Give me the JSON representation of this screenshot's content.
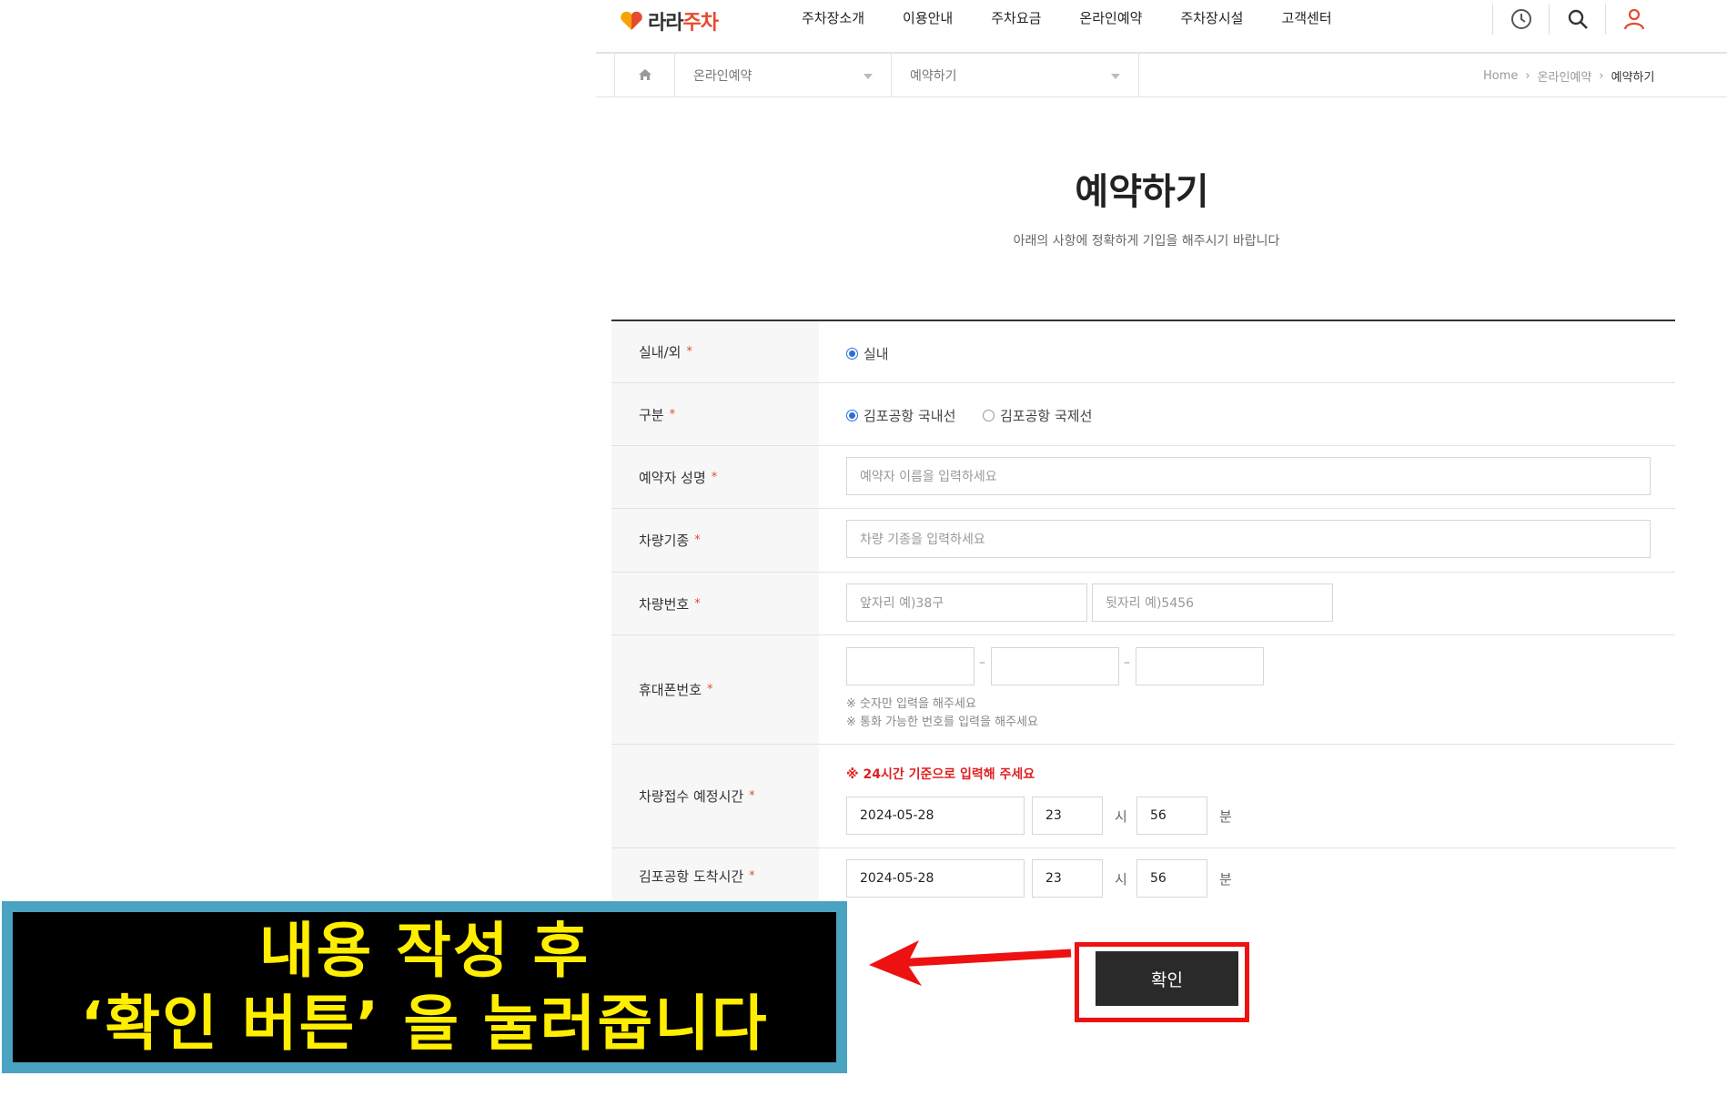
{
  "header": {
    "logo": {
      "part1": "라라",
      "part2": "주차"
    },
    "nav": [
      "주차장소개",
      "이용안내",
      "주차요금",
      "온라인예약",
      "주차장시설",
      "고객센터"
    ],
    "icons": [
      "clock-icon",
      "search-icon",
      "user-icon"
    ]
  },
  "subnav": {
    "menu1": "온라인예약",
    "menu2": "예약하기",
    "breadcrumb": [
      "Home",
      "온라인예약",
      "예약하기"
    ]
  },
  "page": {
    "title": "예약하기",
    "subtitle": "아래의 사항에 정확하게 기입을 해주시기 바랍니다"
  },
  "form": {
    "star": "*",
    "indoor": {
      "label": "실내/외",
      "option": "실내"
    },
    "category": {
      "label": "구분",
      "options": [
        "김포공항 국내선",
        "김포공항 국제선"
      ],
      "selected": "김포공항 국내선"
    },
    "name": {
      "label": "예약자 성명",
      "placeholder": "예약자 이름을 입력하세요"
    },
    "car_model": {
      "label": "차량기종",
      "placeholder": "차량 기종을 입력하세요"
    },
    "car_number": {
      "label": "차량번호",
      "front_placeholder": "앞자리 예)38구",
      "back_placeholder": "뒷자리 예)5456"
    },
    "phone": {
      "label": "휴대폰번호",
      "dash": "–",
      "notes": [
        "※ 숫자만 입력을 해주세요",
        "※ 통화 가능한 번호를 입력을 해주세요"
      ]
    },
    "arrival_time": {
      "label": "차량접수 예정시간",
      "warning": "※ 24시간 기준으로 입력해 주세요",
      "date": "2024-05-28",
      "hour": "23",
      "minute": "56",
      "hour_unit": "시",
      "minute_unit": "분"
    },
    "airport_time": {
      "label": "김포공항 도착시간",
      "date": "2024-05-28",
      "hour": "23",
      "minute": "56",
      "hour_unit": "시",
      "minute_unit": "분"
    },
    "confirm": "확인"
  },
  "callout": {
    "line1": "내용 작성 후",
    "line2": "‘확인 버튼’ 을 눌러줍니다"
  },
  "colors": {
    "accent": "#e64a2e",
    "radio": "#2a6fd8",
    "warning": "#e02020",
    "callout_text": "#ffee00",
    "callout_border": "#4aa3c0",
    "highlight": "#ee1111"
  }
}
